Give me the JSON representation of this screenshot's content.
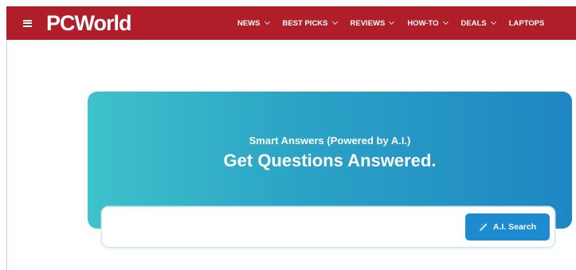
{
  "header": {
    "logo": "PCWorld",
    "nav": [
      {
        "label": "NEWS"
      },
      {
        "label": "BEST PICKS"
      },
      {
        "label": "REVIEWS"
      },
      {
        "label": "HOW-TO"
      },
      {
        "label": "DEALS"
      },
      {
        "label": "LAPTOPS"
      }
    ],
    "icons": {
      "menu": "hamburger-menu-icon",
      "dropdown": "chevron-down-icon"
    }
  },
  "hero": {
    "subtitle": "Smart Answers (Powered by A.I.)",
    "title": "Get Questions Answered.",
    "search_value": "",
    "button_label": "A.I. Search",
    "button_icon": "magic-wand-icon"
  },
  "colors": {
    "brand_red": "#b01e2a",
    "gradient_start": "#3ec2cb",
    "gradient_end": "#1f86c4",
    "button_blue": "#1e8bd0"
  }
}
